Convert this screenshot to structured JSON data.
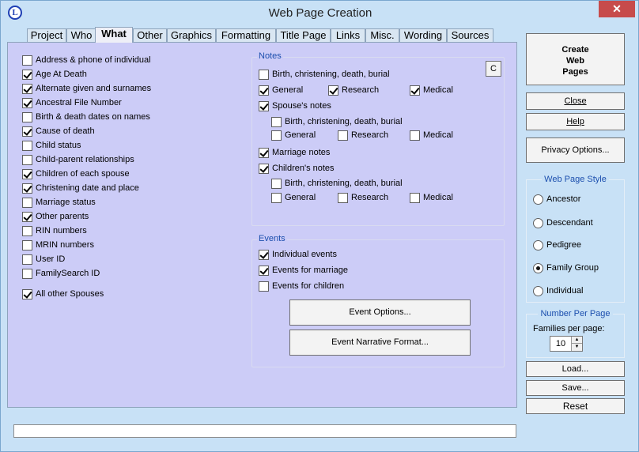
{
  "window": {
    "title": "Web Page Creation",
    "app_icon": "L",
    "close_glyph": "✕"
  },
  "tabs": [
    "Project",
    "Who",
    "What",
    "Other",
    "Graphics",
    "Formatting",
    "Title Page",
    "Links",
    "Misc.",
    "Wording",
    "Sources"
  ],
  "active_tab": "What",
  "what_options": [
    {
      "label": "Address & phone of individual",
      "checked": false
    },
    {
      "label": "Age At Death",
      "checked": true
    },
    {
      "label": "Alternate given and surnames",
      "checked": true
    },
    {
      "label": "Ancestral File Number",
      "checked": true
    },
    {
      "label": "Birth & death dates on names",
      "checked": false
    },
    {
      "label": "Cause of death",
      "checked": true
    },
    {
      "label": "Child status",
      "checked": false
    },
    {
      "label": "Child-parent relationships",
      "checked": false
    },
    {
      "label": "Children of each spouse",
      "checked": true
    },
    {
      "label": "Christening date and place",
      "checked": true
    },
    {
      "label": "Marriage status",
      "checked": false
    },
    {
      "label": "Other parents",
      "checked": true
    },
    {
      "label": "RIN numbers",
      "checked": false
    },
    {
      "label": "MRIN numbers",
      "checked": false
    },
    {
      "label": "User ID",
      "checked": false
    },
    {
      "label": "FamilySearch ID",
      "checked": false
    }
  ],
  "all_other_spouses": {
    "label": "All other Spouses",
    "checked": true
  },
  "notes": {
    "title": "Notes",
    "c_button": "C",
    "birth_label": "Birth, christening, death, burial",
    "birth_checked": false,
    "general": {
      "label": "General",
      "checked": true
    },
    "research": {
      "label": "Research",
      "checked": true
    },
    "medical": {
      "label": "Medical",
      "checked": true
    },
    "spouse": {
      "label": "Spouse's notes",
      "checked": true,
      "birth_label": "Birth, christening, death, burial",
      "birth_checked": false,
      "general": {
        "label": "General",
        "checked": false
      },
      "research": {
        "label": "Research",
        "checked": false
      },
      "medical": {
        "label": "Medical",
        "checked": false
      }
    },
    "marriage": {
      "label": "Marriage notes",
      "checked": true
    },
    "children": {
      "label": "Children's notes",
      "checked": true,
      "birth_label": "Birth, christening, death, burial",
      "birth_checked": false,
      "general": {
        "label": "General",
        "checked": false
      },
      "research": {
        "label": "Research",
        "checked": false
      },
      "medical": {
        "label": "Medical",
        "checked": false
      }
    }
  },
  "events": {
    "title": "Events",
    "individual": {
      "label": "Individual events",
      "checked": true
    },
    "marriage": {
      "label": "Events for marriage",
      "checked": true
    },
    "children": {
      "label": "Events for children",
      "checked": false
    },
    "options_button": "Event Options...",
    "narrative_button": "Event Narrative Format..."
  },
  "side": {
    "create_button": [
      "Create",
      "Web",
      "Pages"
    ],
    "close_button": "Close",
    "help_button": "Help",
    "privacy_button": "Privacy Options...",
    "style_title": "Web Page Style",
    "styles": [
      {
        "label": "Ancestor",
        "selected": false
      },
      {
        "label": "Descendant",
        "selected": false
      },
      {
        "label": "Pedigree",
        "selected": false
      },
      {
        "label": "Family Group",
        "selected": true
      },
      {
        "label": "Individual",
        "selected": false
      }
    ],
    "number_title": "Number Per Page",
    "families_label": "Families per page:",
    "families_value": "10",
    "load_button": "Load...",
    "save_button": "Save...",
    "reset_button": "Reset"
  },
  "status_text": ""
}
